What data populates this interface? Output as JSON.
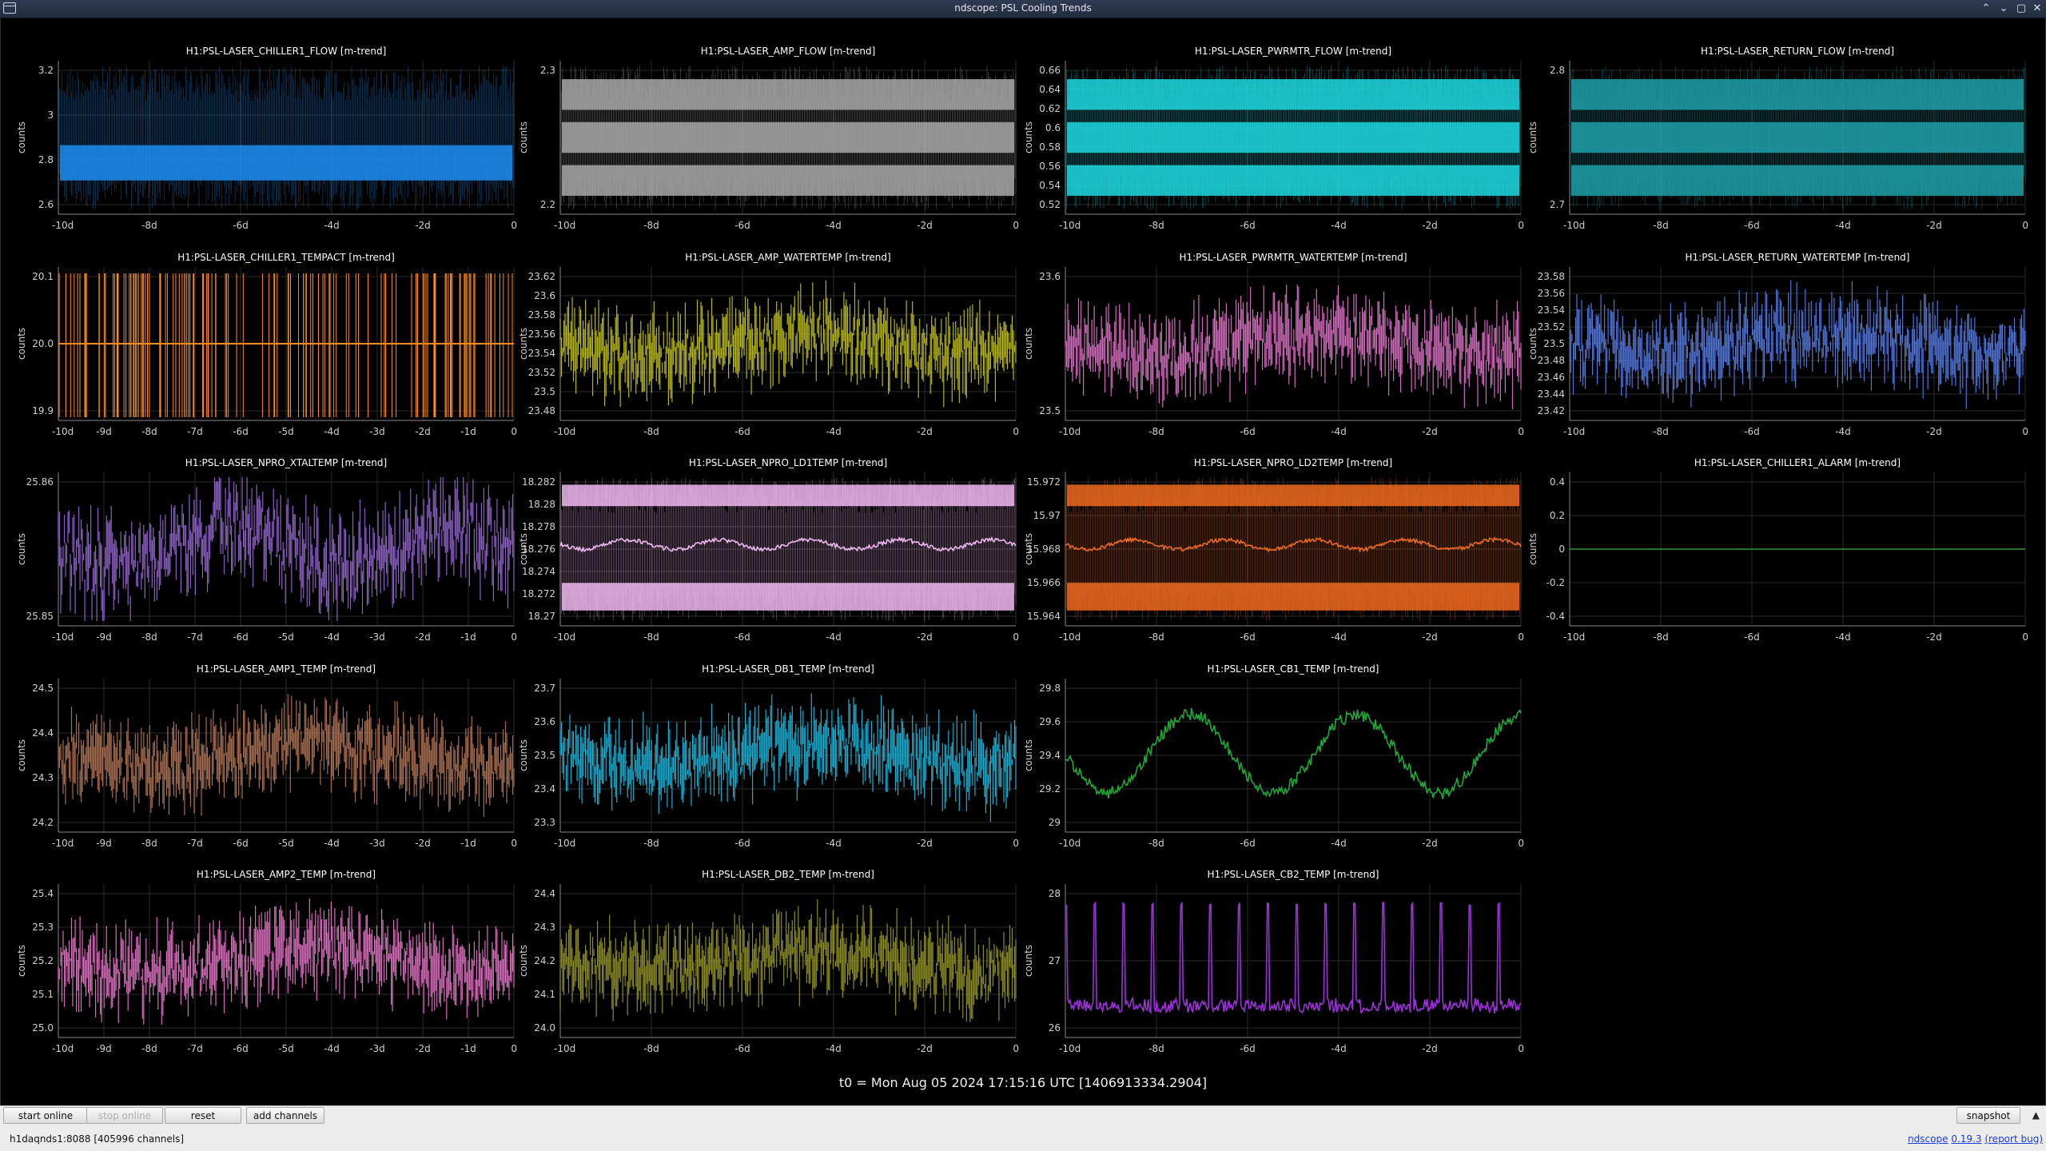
{
  "window": {
    "title": "ndscope: PSL Cooling Trends",
    "btn_min": "⌃",
    "btn_max": "⌄",
    "btn_restore": "▢",
    "btn_close": "✕"
  },
  "ylabel": "counts",
  "palette": {
    "background": "#000000",
    "grid": "#2a2a2a",
    "axis": "#888888"
  },
  "plots": [
    {
      "title": "H1:PSL-LASER_CHILLER1_FLOW [m-trend]",
      "color": "#1e8ef0",
      "ticks": [
        "3.2",
        "3",
        "2.8",
        "2.6"
      ],
      "xticks": [
        "-10d",
        "-8d",
        "-6d",
        "-4d",
        "-2d",
        "0"
      ],
      "style": "band"
    },
    {
      "title": "H1:PSL-LASER_AMP_FLOW [m-trend]",
      "color": "#a8a8a8",
      "ticks": [
        "2.3",
        "2.2"
      ],
      "xticks": [
        "-10d",
        "-8d",
        "-6d",
        "-4d",
        "-2d",
        "0"
      ],
      "style": "multiband"
    },
    {
      "title": "H1:PSL-LASER_PWRMTR_FLOW [m-trend]",
      "color": "#1ed8e0",
      "ticks": [
        "0.66",
        "0.64",
        "0.62",
        "0.6",
        "0.58",
        "0.56",
        "0.54",
        "0.52"
      ],
      "xticks": [
        "-10d",
        "-8d",
        "-6d",
        "-4d",
        "-2d",
        "0"
      ],
      "style": "multiband"
    },
    {
      "title": "H1:PSL-LASER_RETURN_FLOW [m-trend]",
      "color": "#1fa0a8",
      "ticks": [
        "2.8",
        "2.7"
      ],
      "xticks": [
        "-10d",
        "-8d",
        "-6d",
        "-4d",
        "-2d",
        "0"
      ],
      "style": "multiband"
    },
    {
      "title": "H1:PSL-LASER_CHILLER1_TEMPACT [m-trend]",
      "color": "#ff8c1a",
      "ticks": [
        "20.1",
        "20.0",
        "19.9"
      ],
      "xticks": [
        "-10d",
        "-9d",
        "-8d",
        "-7d",
        "-6d",
        "-5d",
        "-4d",
        "-3d",
        "-2d",
        "-1d",
        "0"
      ],
      "style": "steps"
    },
    {
      "title": "H1:PSL-LASER_AMP_WATERTEMP [m-trend]",
      "color": "#c8c81e",
      "ticks": [
        "23.62",
        "23.6",
        "23.58",
        "23.56",
        "23.54",
        "23.52",
        "23.5",
        "23.48"
      ],
      "xticks": [
        "-10d",
        "-8d",
        "-6d",
        "-4d",
        "-2d",
        "0"
      ],
      "style": "noise"
    },
    {
      "title": "H1:PSL-LASER_PWRMTR_WATERTEMP [m-trend]",
      "color": "#e878d0",
      "ticks": [
        "23.6",
        "23.5"
      ],
      "xticks": [
        "-10d",
        "-8d",
        "-6d",
        "-4d",
        "-2d",
        "0"
      ],
      "style": "noise"
    },
    {
      "title": "H1:PSL-LASER_RETURN_WATERTEMP [m-trend]",
      "color": "#5a82f0",
      "ticks": [
        "23.58",
        "23.56",
        "23.54",
        "23.52",
        "23.5",
        "23.48",
        "23.46",
        "23.44",
        "23.42"
      ],
      "xticks": [
        "-10d",
        "-8d",
        "-6d",
        "-4d",
        "-2d",
        "0"
      ],
      "style": "noise"
    },
    {
      "title": "H1:PSL-LASER_NPRO_XTALTEMP [m-trend]",
      "color": "#9a6ad8",
      "ticks": [
        "25.86",
        "25.85"
      ],
      "xticks": [
        "-10d",
        "-9d",
        "-8d",
        "-7d",
        "-6d",
        "-5d",
        "-4d",
        "-3d",
        "-2d",
        "-1d",
        "0"
      ],
      "style": "wander"
    },
    {
      "title": "H1:PSL-LASER_NPRO_LD1TEMP [m-trend]",
      "color": "#f0b8f0",
      "ticks": [
        "18.282",
        "18.28",
        "18.278",
        "18.276",
        "18.274",
        "18.272",
        "18.27"
      ],
      "xticks": [
        "-10d",
        "-8d",
        "-6d",
        "-4d",
        "-2d",
        "0"
      ],
      "style": "ld"
    },
    {
      "title": "H1:PSL-LASER_NPRO_LD2TEMP [m-trend]",
      "color": "#ee6a20",
      "ticks": [
        "15.972",
        "15.97",
        "15.968",
        "15.966",
        "15.964"
      ],
      "xticks": [
        "-10d",
        "-8d",
        "-6d",
        "-4d",
        "-2d",
        "0"
      ],
      "style": "ld"
    },
    {
      "title": "H1:PSL-LASER_CHILLER1_ALARM [m-trend]",
      "color": "#2e9a2e",
      "ticks": [
        "0.4",
        "0.2",
        "0",
        "-0.2",
        "-0.4"
      ],
      "xticks": [
        "-10d",
        "-8d",
        "-6d",
        "-4d",
        "-2d",
        "0"
      ],
      "style": "flat"
    },
    {
      "title": "H1:PSL-LASER_AMP1_TEMP [m-trend]",
      "color": "#b87a5a",
      "ticks": [
        "24.5",
        "24.4",
        "24.3",
        "24.2"
      ],
      "xticks": [
        "-10d",
        "-9d",
        "-8d",
        "-7d",
        "-6d",
        "-5d",
        "-4d",
        "-3d",
        "-2d",
        "-1d",
        "0"
      ],
      "style": "noise"
    },
    {
      "title": "H1:PSL-LASER_DB1_TEMP [m-trend]",
      "color": "#1ec0e8",
      "ticks": [
        "23.7",
        "23.6",
        "23.5",
        "23.4",
        "23.3"
      ],
      "xticks": [
        "-10d",
        "-8d",
        "-6d",
        "-4d",
        "-2d",
        "0"
      ],
      "style": "noise"
    },
    {
      "title": "H1:PSL-LASER_CB1_TEMP [m-trend]",
      "color": "#22a83a",
      "ticks": [
        "29.8",
        "29.6",
        "29.4",
        "29.2",
        "29"
      ],
      "xticks": [
        "-10d",
        "-8d",
        "-6d",
        "-4d",
        "-2d",
        "0"
      ],
      "style": "wave"
    },
    null,
    {
      "title": "H1:PSL-LASER_AMP2_TEMP [m-trend]",
      "color": "#f07ad0",
      "ticks": [
        "25.4",
        "25.3",
        "25.2",
        "25.1",
        "25.0"
      ],
      "xticks": [
        "-10d",
        "-9d",
        "-8d",
        "-7d",
        "-6d",
        "-5d",
        "-4d",
        "-3d",
        "-2d",
        "-1d",
        "0"
      ],
      "style": "noise"
    },
    {
      "title": "H1:PSL-LASER_DB2_TEMP [m-trend]",
      "color": "#9a9a2a",
      "ticks": [
        "24.4",
        "24.3",
        "24.2",
        "24.1",
        "24.0"
      ],
      "xticks": [
        "-10d",
        "-8d",
        "-6d",
        "-4d",
        "-2d",
        "0"
      ],
      "style": "noise"
    },
    {
      "title": "H1:PSL-LASER_CB2_TEMP [m-trend]",
      "color": "#9a32d8",
      "ticks": [
        "28",
        "27",
        "26"
      ],
      "xticks": [
        "-10d",
        "-8d",
        "-6d",
        "-4d",
        "-2d",
        "0"
      ],
      "style": "spikes"
    },
    null
  ],
  "t0_label": "t0 = Mon Aug 05 2024 17:15:16 UTC [1406913334.2904]",
  "toolbar": {
    "start_online": "start online",
    "stop_online": "stop online",
    "reset": "reset",
    "add_channels": "add channels",
    "snapshot": "snapshot",
    "scroll_up": "▲"
  },
  "status": {
    "server": "h1daqnds1:8088  [405996 channels]",
    "app_name": "ndscope",
    "version": "0.19.3",
    "report_bug": "(report bug)"
  }
}
